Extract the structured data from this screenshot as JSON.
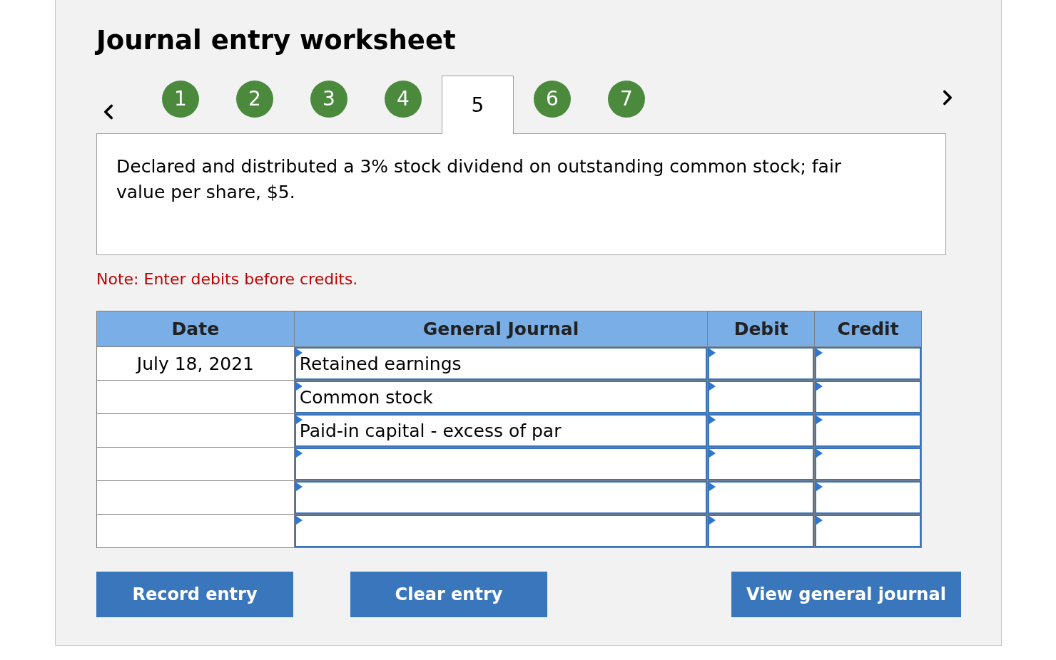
{
  "title": "Journal entry worksheet",
  "tabs": [
    {
      "label": "1",
      "selected": false
    },
    {
      "label": "2",
      "selected": false
    },
    {
      "label": "3",
      "selected": false
    },
    {
      "label": "4",
      "selected": false
    },
    {
      "label": "5",
      "selected": true
    },
    {
      "label": "6",
      "selected": false
    },
    {
      "label": "7",
      "selected": false
    }
  ],
  "description": "Declared and distributed a 3% stock dividend on outstanding common stock; fair value per share, $5.",
  "note": "Note: Enter debits before credits.",
  "table": {
    "columns": [
      "Date",
      "General Journal",
      "Debit",
      "Credit"
    ],
    "rows": [
      {
        "date": "July 18, 2021",
        "account": "Retained earnings"
      },
      {
        "account": "Common stock"
      },
      {
        "account": "Paid-in capital - excess of par"
      },
      {},
      {},
      {}
    ]
  },
  "buttons": [
    "Record entry",
    "Clear entry",
    "View general journal"
  ]
}
